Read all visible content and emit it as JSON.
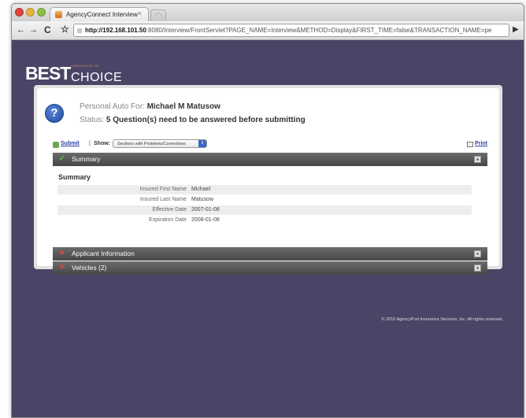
{
  "browser": {
    "tab_title": "AgencyConnect Interview",
    "tab_close": "×",
    "new_tab": "◠",
    "url_host": "http://192.168.101.50",
    "url_rest": ":8080/Interview/FrontServlet?PAGE_NAME=Interview&METHOD=Display&FIRST_TIME=false&TRANSACTION_NAME=pe",
    "back": "←",
    "forward": "→",
    "reload": "C",
    "star": "☆",
    "go": "▶"
  },
  "logo": {
    "best": "BEST",
    "choice": "CHOICE",
    "tagline": "INSURANCE OF"
  },
  "header": {
    "help_glyph": "?",
    "policy_prefix": "Personal Auto For:",
    "policy_name": "Michael M Matusow",
    "status_prefix": "Status:",
    "status_value": "5 Question(s) need to be answered before submitting"
  },
  "actions": {
    "submit": "Submit",
    "separator": "|",
    "show_label": "Show:",
    "show_selected": "Sections with Problems/Corrections",
    "select_arrow": "⇕",
    "print": "Print"
  },
  "sections": [
    {
      "label": "Summary",
      "status": "complete",
      "glyph": "✓",
      "toggle": "▪"
    },
    {
      "label": "Applicant Information",
      "status": "problem",
      "glyph": "✕",
      "toggle": "▪"
    },
    {
      "label": "Vehicles (2)",
      "status": "problem",
      "glyph": "✕",
      "toggle": "▪"
    }
  ],
  "summary": {
    "title": "Summary",
    "rows": [
      {
        "label": "Insured First Name",
        "value": "Michael"
      },
      {
        "label": "Insured Last Name",
        "value": "Matusow"
      },
      {
        "label": "Effective Date",
        "value": "2007-01-08"
      },
      {
        "label": "Expiration Date",
        "value": "2008-01-08"
      }
    ]
  },
  "footer": "© 2010 AgencyPort Insurance Services, Inc. All rights reserved.",
  "colors": {
    "page_background": "#4a4466",
    "section_bar": "#555555",
    "link": "#2a3ea8",
    "check": "#6ccc4a",
    "error": "#e04a3c"
  }
}
